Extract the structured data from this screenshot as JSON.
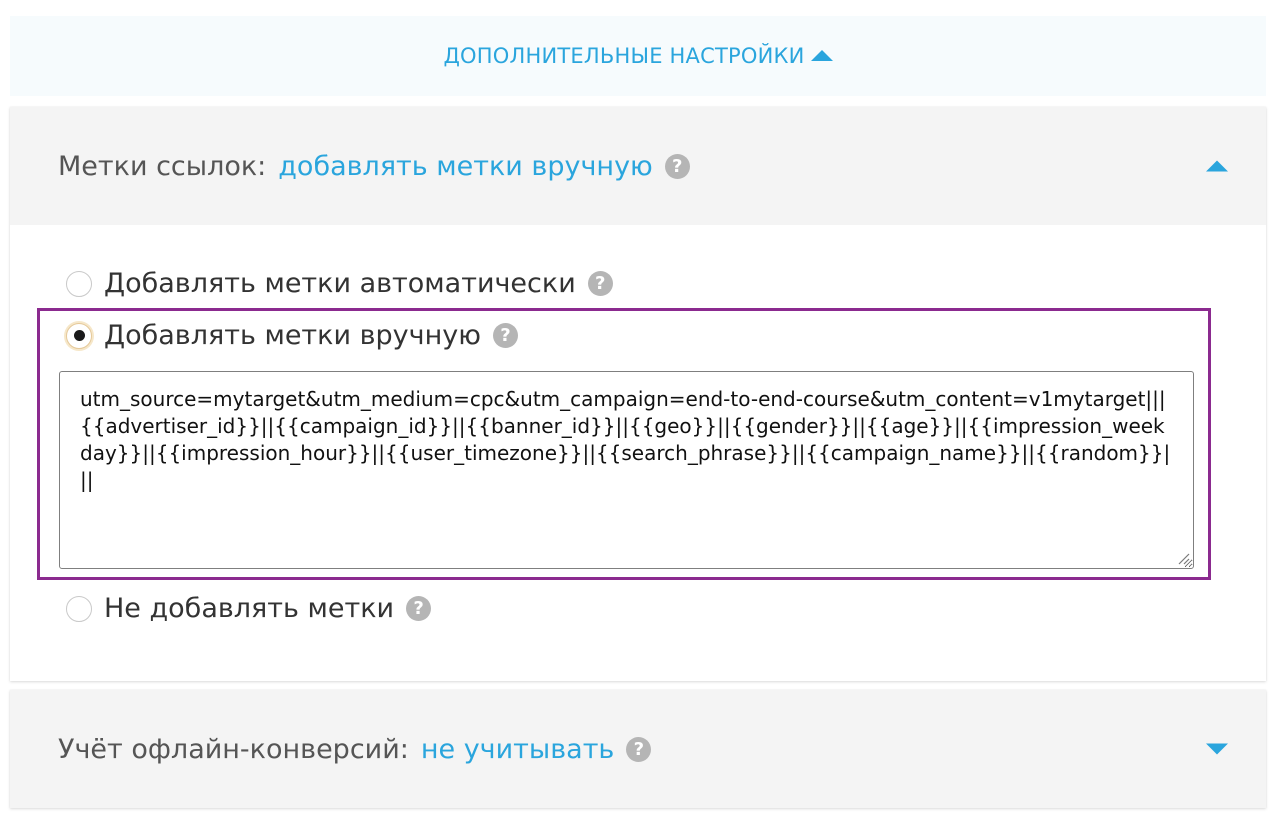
{
  "advanced": {
    "label": "ДОПОЛНИТЕЛЬНЫЕ НАСТРОЙКИ"
  },
  "link_tags": {
    "label": "Метки ссылок:",
    "value": "добавлять метки вручную",
    "help": "?",
    "expanded": true,
    "options": [
      {
        "label": "Добавлять метки автоматически",
        "checked": false,
        "help": "?"
      },
      {
        "label": "Добавлять метки вручную",
        "checked": true,
        "help": "?"
      },
      {
        "label": "Не добавлять метки",
        "checked": false,
        "help": "?"
      }
    ],
    "manual_value": "utm_source=mytarget&utm_medium=cpc&utm_campaign=end-to-end-course&utm_content=v1mytarget|||{{advertiser_id}}||{{campaign_id}}||{{banner_id}}||{{geo}}||{{gender}}||{{age}}||{{impression_weekday}}||{{impression_hour}}||{{user_timezone}}||{{search_phrase}}||{{campaign_name}}||{{random}}|||"
  },
  "offline_conversions": {
    "label": "Учёт офлайн-конверсий:",
    "value": "не учитывать",
    "help": "?",
    "expanded": false
  },
  "colors": {
    "accent": "#2aa5dd",
    "highlight": "#8b2a8f",
    "header_bg": "#f4f4f4",
    "help_bg": "#b5b5b5"
  },
  "icons": {
    "advanced_toggle": "triangle-up-icon",
    "link_tags_caret": "triangle-up-icon",
    "offline_caret": "triangle-down-icon",
    "help": "question-circle-icon"
  }
}
